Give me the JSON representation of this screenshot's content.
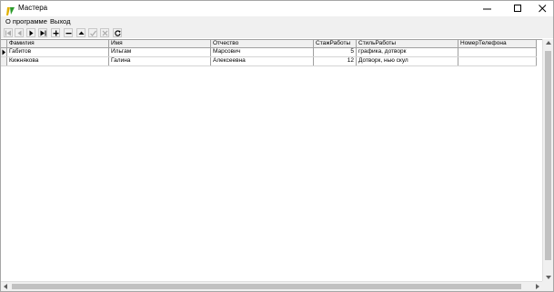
{
  "window": {
    "title": "Мастера"
  },
  "menu": [
    {
      "label": "О программе"
    },
    {
      "label": "Выход"
    }
  ],
  "toolbar": [
    {
      "name": "first-record",
      "icon": "first-icon",
      "enabled": false
    },
    {
      "name": "prior-record",
      "icon": "prior-icon",
      "enabled": false
    },
    {
      "name": "next-record",
      "icon": "next-icon",
      "enabled": true
    },
    {
      "name": "last-record",
      "icon": "last-icon",
      "enabled": true
    },
    {
      "name": "insert-record",
      "icon": "plus-icon",
      "enabled": true
    },
    {
      "name": "delete-record",
      "icon": "minus-icon",
      "enabled": true
    },
    {
      "name": "edit-record",
      "icon": "edit-up-icon",
      "enabled": true
    },
    {
      "name": "post-edit",
      "icon": "check-icon",
      "enabled": false
    },
    {
      "name": "cancel-edit",
      "icon": "x-icon",
      "enabled": false
    },
    {
      "name": "refresh-data",
      "icon": "refresh-icon",
      "enabled": true
    }
  ],
  "grid": {
    "columns": [
      "Фамилия",
      "Имя",
      "Отчество",
      "СтажРаботы",
      "СтильРаботы",
      "НомерТелефона"
    ],
    "rows": [
      [
        "Габитов",
        "Ильгам",
        "Марсович",
        "5",
        "графика, дотворк",
        ""
      ],
      [
        "Кижнякова",
        "Галина",
        "Алексеевна",
        "12",
        "Дотворк, нью скул",
        ""
      ]
    ]
  }
}
